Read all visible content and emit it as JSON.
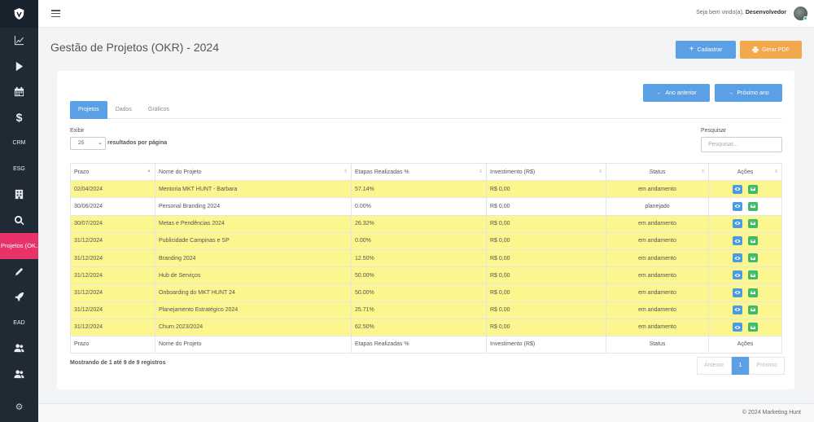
{
  "topbar": {
    "welcome_prefix": "Seja bem vindo(a),",
    "user_name": "Desenvolvedor"
  },
  "sidebar": {
    "items": [
      {
        "icon": "chart-icon"
      },
      {
        "icon": "play-icon"
      },
      {
        "icon": "calendar-icon"
      },
      {
        "icon": "dollar-icon"
      },
      {
        "label": "CRM"
      },
      {
        "label": "ESG"
      },
      {
        "icon": "building-icon"
      },
      {
        "icon": "search-icon"
      },
      {
        "label": "Projetos (OK..."
      },
      {
        "icon": "pencil-icon"
      },
      {
        "icon": "rocket-icon"
      },
      {
        "label": "EAD"
      },
      {
        "icon": "users-icon"
      },
      {
        "icon": "users-icon"
      }
    ]
  },
  "page": {
    "title": "Gestão de Projetos (OKR) - 2024",
    "cadastrar": "Cadastrar",
    "gerar_pdf": "Gerar PDF",
    "ano_anterior": "Ano anterior",
    "proximo_ano": "Próximo ano"
  },
  "tabs": [
    "Projetos",
    "Dados",
    "Gráficos"
  ],
  "controls": {
    "exibir": "Exibir",
    "page_size": "25",
    "per_page": "resultados por página",
    "pesquisar": "Pesquisar",
    "search_placeholder": "Pesquisar..."
  },
  "table": {
    "columns": [
      "Prazo",
      "Nome do Projeto",
      "Etapas Realizadas %",
      "Investimento (R$)",
      "Status",
      "Ações"
    ],
    "rows": [
      {
        "prazo": "02/04/2024",
        "nome": "Mentoria MKT HUNT - Barbara",
        "etapas": "57.14%",
        "invest": "R$ 0,00",
        "status": "em andamento",
        "highlight": true
      },
      {
        "prazo": "30/06/2024",
        "nome": "Personal Branding 2024",
        "etapas": "0.00%",
        "invest": "R$ 0,00",
        "status": "planejado",
        "highlight": false
      },
      {
        "prazo": "30/07/2024",
        "nome": "Metas e Pendências 2024",
        "etapas": "26.32%",
        "invest": "R$ 0,00",
        "status": "em andamento",
        "highlight": true
      },
      {
        "prazo": "31/12/2024",
        "nome": "Publicidade Campinas e SP",
        "etapas": "0.00%",
        "invest": "R$ 0,00",
        "status": "em andamento",
        "highlight": true
      },
      {
        "prazo": "31/12/2024",
        "nome": "Branding 2024",
        "etapas": "12.50%",
        "invest": "R$ 0,00",
        "status": "em andamento",
        "highlight": true
      },
      {
        "prazo": "31/12/2024",
        "nome": "Hub de Serviços",
        "etapas": "50.00%",
        "invest": "R$ 0,00",
        "status": "em andamento",
        "highlight": true
      },
      {
        "prazo": "31/12/2024",
        "nome": "Onboarding do MKT HUNT 24",
        "etapas": "50.00%",
        "invest": "R$ 0,00",
        "status": "em andamento",
        "highlight": true
      },
      {
        "prazo": "31/12/2024",
        "nome": "Planejamento Estratégico 2024",
        "etapas": "25.71%",
        "invest": "R$ 0,00",
        "status": "em andamento",
        "highlight": true
      },
      {
        "prazo": "31/12/2024",
        "nome": "Churn 2023/2024",
        "etapas": "62.50%",
        "invest": "R$ 0,00",
        "status": "em andamento",
        "highlight": true
      }
    ]
  },
  "showing": "Mostrando de 1 até 9 de 9 registros",
  "pagination": {
    "prev": "Anterior",
    "current": "1",
    "next": "Próximo"
  },
  "footer": "© 2024 Marketing Hunt",
  "colors": {
    "accent": "#5ba0e5",
    "highlight_row": "#fbf68e",
    "sidebar": "#1f2a35",
    "active_menu": "#e7336a",
    "pdf_button": "#f2a94e"
  }
}
